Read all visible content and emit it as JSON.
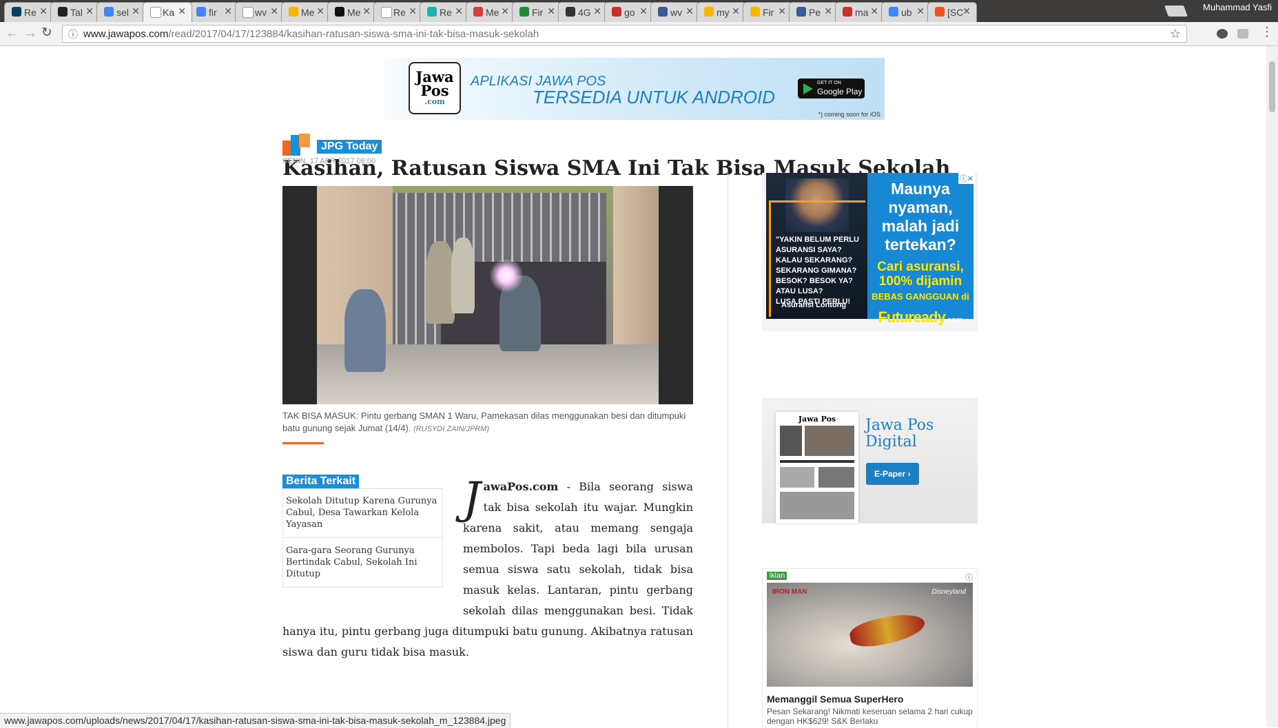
{
  "browser": {
    "tabs": [
      {
        "label": "Re",
        "color": "#0a3d62"
      },
      {
        "label": "Tal",
        "color": "#222222"
      },
      {
        "label": "sel",
        "color": "#4285f4"
      },
      {
        "label": "Ka",
        "color": "#ffffff"
      },
      {
        "label": "fir",
        "color": "#4285f4"
      },
      {
        "label": "wv",
        "color": "#ffffff"
      },
      {
        "label": "Me",
        "color": "#f7b500"
      },
      {
        "label": "Me",
        "color": "#111111"
      },
      {
        "label": "Re",
        "color": "#ffffff"
      },
      {
        "label": "Re",
        "color": "#20b2aa"
      },
      {
        "label": "Me",
        "color": "#d43f3a"
      },
      {
        "label": "Fir",
        "color": "#1e8c3a"
      },
      {
        "label": "4G",
        "color": "#333333"
      },
      {
        "label": "go",
        "color": "#c9302c"
      },
      {
        "label": "wv",
        "color": "#3b5998"
      },
      {
        "label": "my",
        "color": "#f7b500"
      },
      {
        "label": "Fir",
        "color": "#f7b500"
      },
      {
        "label": "Pe",
        "color": "#3b5998"
      },
      {
        "label": "ma",
        "color": "#c9302c"
      },
      {
        "label": "ub",
        "color": "#4285f4"
      },
      {
        "label": "[SC",
        "color": "#e95420"
      }
    ],
    "user_name": "Muhammad Yasfi",
    "url_host": "www.jawapos.com",
    "url_path": "/read/2017/04/17/123884/kasihan-ratusan-siswa-sma-ini-tak-bisa-masuk-sekolah",
    "status_url": "www.jawapos.com/uploads/news/2017/04/17/kasihan-ratusan-siswa-sma-ini-tak-bisa-masuk-sekolah_m_123884.jpeg"
  },
  "banner": {
    "logo_line1": "Jawa",
    "logo_line2": "Pos",
    "logo_line3": ".com",
    "line1": "APLIKASI JAWA POS",
    "line2": "TERSEDIA UNTUK ANDROID",
    "store_small": "GET IT ON",
    "store_label": "Google Play",
    "ios_note": "*) coming soon for iOS"
  },
  "article": {
    "category": "JPG Today",
    "title": "Kasihan, Ratusan Siswa SMA Ini Tak Bisa Masuk Sekolah",
    "date": "SENIN, 17 APR 2017 06:00",
    "caption": "TAK BISA MASUK: Pintu gerbang SMAN 1 Waru, Pamekasan dilas menggunakan besi dan ditumpuki batu gunung sejak Jumat (14/4).",
    "caption_credit": "(RUSYDI ZAIN/JPRM)",
    "drop_cap": "J",
    "brand": "awaPos.com",
    "body": " - Bila seorang siswa tak bisa sekolah itu wajar. Mungkin karena sakit, atau memang sengaja membolos. Tapi beda lagi bila urusan semua siswa satu sekolah, tidak bisa masuk kelas. Lantaran, pintu gerbang sekolah dilas menggunakan besi. Tidak hanya itu, pintu gerbang juga ditumpuki batu gunung. Akibatnya ratusan siswa dan guru tidak bisa masuk."
  },
  "related": {
    "heading": "Berita Terkait",
    "items": [
      "Sekolah Ditutup Karena Gurunya Cabul, Desa Tawarkan Kelola Yayasan",
      "Gara-gara Seorang Gurunya Bertindak Cabul, Sekolah Ini Ditutup"
    ]
  },
  "ad_insurance": {
    "quote_lines": [
      "\"YAKIN BELUM PERLU",
      "ASURANSI SAYA?",
      "KALAU SEKARANG?",
      "SEKARANG GIMANA?",
      "BESOK? BESOK YA?",
      "ATAU LUSA?",
      "LUSA PASTI PERLU!"
    ],
    "signature": "Asuransi Lontong",
    "headline": "Maunya nyaman, malah jadi tertekan?",
    "subhead": "Cari asuransi, 100% dijamin",
    "tagline": "BEBAS GANGGUAN di",
    "brand": "Futuready",
    "brand_suffix": ".com"
  },
  "digital": {
    "masthead": "Jawa Pos",
    "title": "Jawa Pos Digital",
    "button": "E-Paper ›"
  },
  "ad_ironman": {
    "label": "Iklan",
    "marvel_text": "IRON MAN",
    "partner": "Disneyland",
    "headline": "Memanggil Semua SuperHero",
    "desc": "Pesan Sekarang! Nikmati keseruan selama 2 hari cukup dengan HK$629! S&K Berlaku"
  }
}
